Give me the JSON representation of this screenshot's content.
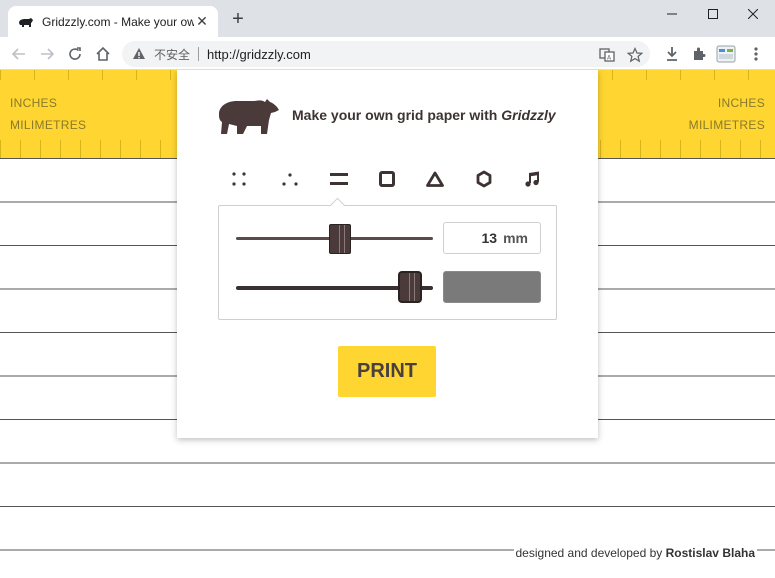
{
  "browser": {
    "tab": {
      "title": "Gridzzly.com - Make your own",
      "close_glyph": "✕"
    },
    "new_tab_glyph": "+",
    "omnibox": {
      "security_label": "不安全",
      "url": "http://gridzzly.com"
    }
  },
  "page": {
    "ruler": {
      "left_top": "INCHES",
      "left_bottom": "MILIMETRES",
      "right_top": "INCHES",
      "right_bottom": "MILIMETRES"
    },
    "credit": {
      "prefix": "designed and developed by ",
      "author": "Rostislav Blaha"
    }
  },
  "panel": {
    "headline_text": "Make your own grid paper with ",
    "headline_brand": "Gridzzly",
    "patterns": [
      "dots-grid-icon",
      "triangular-dots-icon",
      "lines-icon",
      "square-grid-icon",
      "triangle-grid-icon",
      "hexagon-grid-icon",
      "music-staff-icon"
    ],
    "selected_pattern": "lines-icon",
    "spacing": {
      "value": "13",
      "unit": "mm"
    },
    "line_thickness_level": 0.9,
    "line_color": "#7a7a7a",
    "print_label": "PRINT"
  },
  "colors": {
    "accent_yellow": "#fed531",
    "bear_brown": "#4a3a3a"
  }
}
